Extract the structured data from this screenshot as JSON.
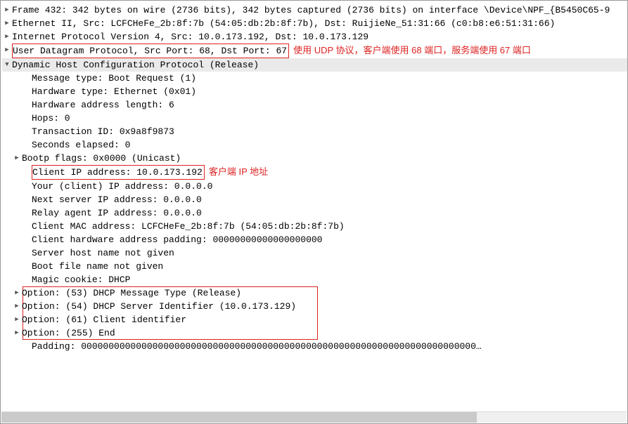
{
  "frame": "Frame 432: 342 bytes on wire (2736 bits), 342 bytes captured (2736 bits) on interface \\Device\\NPF_{B5450C65-9",
  "ethernet": "Ethernet II, Src: LCFCHeFe_2b:8f:7b (54:05:db:2b:8f:7b), Dst: RuijieNe_51:31:66 (c0:b8:e6:51:31:66)",
  "ip": "Internet Protocol Version 4, Src: 10.0.173.192, Dst: 10.0.173.129",
  "udp": "User Datagram Protocol, Src Port: 68, Dst Port: 67",
  "udp_note": "使用 UDP 协议，客户端使用 68 端口，服务端使用 67 端口",
  "dhcp_header": "Dynamic Host Configuration Protocol (Release)",
  "fields": {
    "msg_type": "Message type: Boot Request (1)",
    "hw_type": "Hardware type: Ethernet (0x01)",
    "hw_len": "Hardware address length: 6",
    "hops": "Hops: 0",
    "txid": "Transaction ID: 0x9a8f9873",
    "secs": "Seconds elapsed: 0",
    "flags": "Bootp flags: 0x0000 (Unicast)",
    "ciaddr": "Client IP address: 10.0.173.192",
    "ciaddr_note": "客户端 IP 地址",
    "yiaddr": "Your (client) IP address: 0.0.0.0",
    "siaddr": "Next server IP address: 0.0.0.0",
    "giaddr": "Relay agent IP address: 0.0.0.0",
    "chaddr": "Client MAC address: LCFCHeFe_2b:8f:7b (54:05:db:2b:8f:7b)",
    "padding": "Client hardware address padding: 00000000000000000000",
    "sname": "Server host name not given",
    "file": "Boot file name not given",
    "cookie": "Magic cookie: DHCP",
    "opt53": "Option: (53) DHCP Message Type (Release)",
    "opt54": "Option: (54) DHCP Server Identifier (10.0.173.129)",
    "opt61": "Option: (61) Client identifier",
    "opt255": "Option: (255) End",
    "pad": "Padding: 000000000000000000000000000000000000000000000000000000000000000000000000…"
  }
}
